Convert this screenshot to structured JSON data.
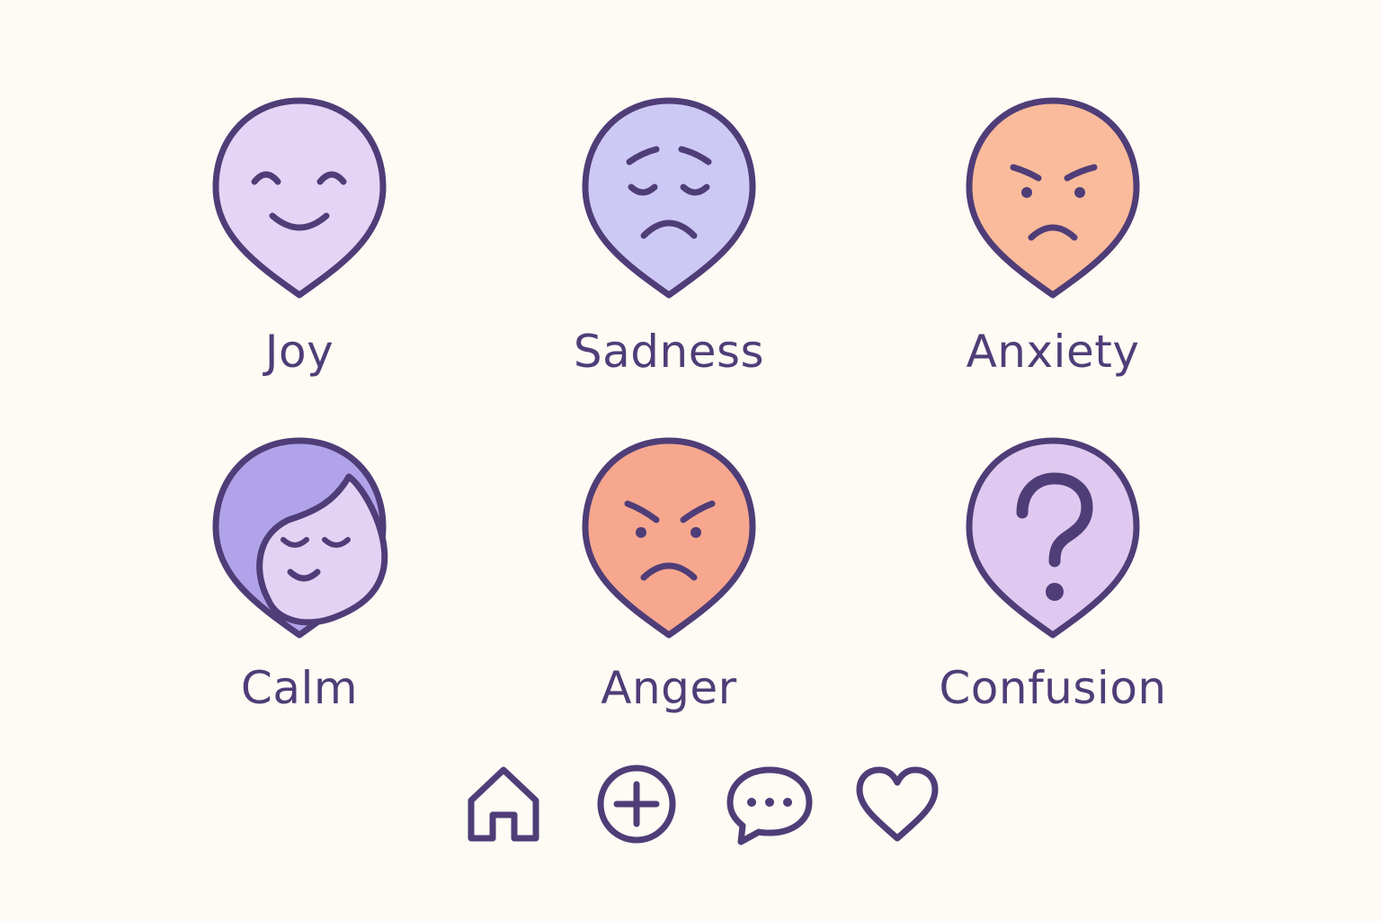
{
  "emotions": [
    {
      "label": "Joy",
      "icon": "smiling-face-icon",
      "fill": "#e5d4f5"
    },
    {
      "label": "Sadness",
      "icon": "sad-face-icon",
      "fill": "#cdc9f5"
    },
    {
      "label": "Anxiety",
      "icon": "frowning-face-icon",
      "fill": "#f9bb9b"
    },
    {
      "label": "Calm",
      "icon": "calm-face-with-hair-icon",
      "fill": "#e3d2f3",
      "accent": "#b1a3ea"
    },
    {
      "label": "Anger",
      "icon": "angry-face-icon",
      "fill": "#f6a78e"
    },
    {
      "label": "Confusion",
      "icon": "question-mark-icon",
      "fill": "#dfc9f0"
    }
  ],
  "nav": [
    {
      "icon": "home-icon"
    },
    {
      "icon": "add-circle-icon"
    },
    {
      "icon": "chat-bubble-icon"
    },
    {
      "icon": "heart-icon"
    }
  ],
  "colors": {
    "background": "#fdfbf4",
    "outline": "#4f3d78",
    "text": "#4f3d78"
  }
}
